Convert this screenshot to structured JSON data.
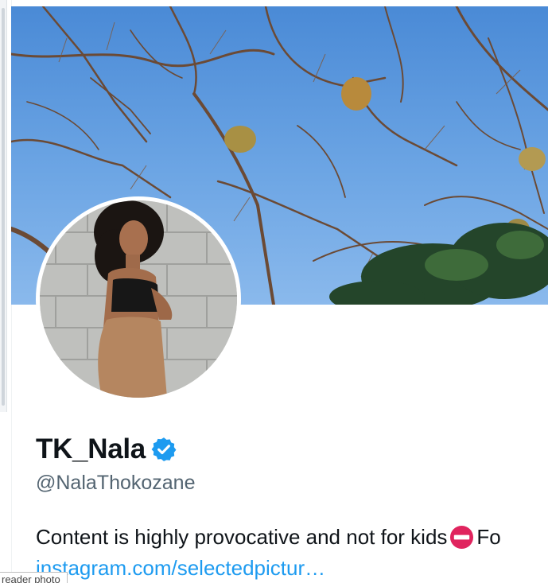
{
  "profile": {
    "display_name": "TK_Nala",
    "handle": "@NalaThokozane",
    "bio_text": "Content is highly provocative and not for kids",
    "bio_trailing": "Fo",
    "link_text": "instagram.com/selectedpictur…",
    "verified_badge": "verified-badge-icon",
    "bio_emoji": "no-entry-icon"
  },
  "tooltip": {
    "text": "reader photo"
  },
  "colors": {
    "text_primary": "#0f1419",
    "text_secondary": "#536471",
    "link": "#1d9bf0",
    "verified": "#1d9bf0",
    "no_entry": "#e0245e"
  }
}
